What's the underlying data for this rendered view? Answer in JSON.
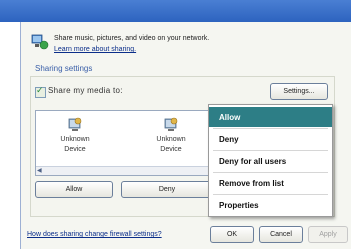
{
  "info": {
    "text": "Share music, pictures, and video on your network.",
    "link": "Learn more about sharing."
  },
  "sharing": {
    "heading": "Sharing settings",
    "share_label": "Share my media to:",
    "share_checked": true,
    "settings_button": "Settings..."
  },
  "devices": [
    {
      "line1": "Unknown",
      "line2": "Device",
      "icon": "device-icon"
    },
    {
      "line1": "Unknown",
      "line2": "Device",
      "icon": "device-icon"
    }
  ],
  "actions": {
    "allow": "Allow",
    "deny": "Deny"
  },
  "context_menu": {
    "items": [
      "Allow",
      "Deny",
      "Deny for all users",
      "Remove from list",
      "Properties"
    ],
    "selected": "Allow"
  },
  "footer": {
    "firewall_link": "How does sharing change firewall settings?",
    "ok": "OK",
    "cancel": "Cancel",
    "apply": "Apply"
  },
  "colors": {
    "menu_highlight": "#2d7e86",
    "link": "#0b2e8a",
    "heading": "#3a5fa8"
  }
}
